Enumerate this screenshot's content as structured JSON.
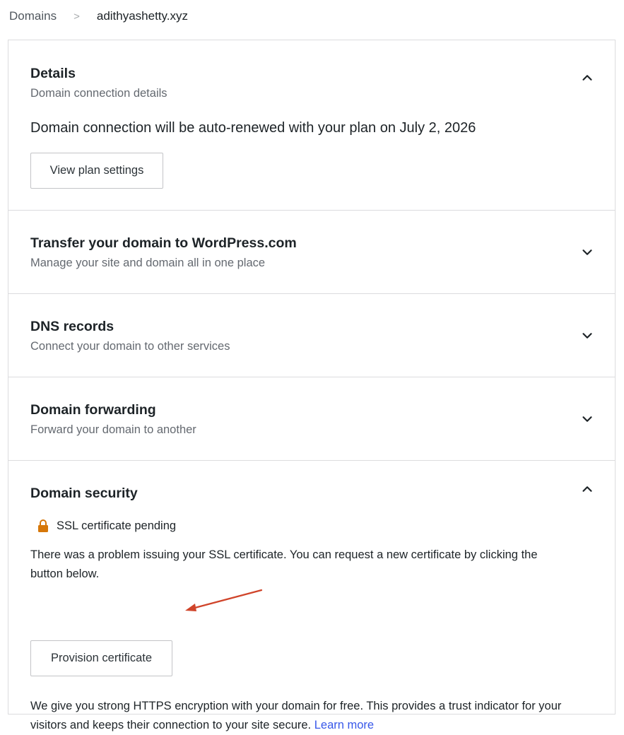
{
  "breadcrumb": {
    "root": "Domains",
    "separator": ">",
    "current": "adithyashetty.xyz"
  },
  "sections": {
    "details": {
      "title": "Details",
      "subtitle": "Domain connection details",
      "renewal_text": "Domain connection will be auto-renewed with your plan on July 2, 2026",
      "button_label": "View plan settings",
      "expanded": true
    },
    "transfer": {
      "title": "Transfer your domain to WordPress.com",
      "subtitle": "Manage your site and domain all in one place",
      "expanded": false
    },
    "dns": {
      "title": "DNS records",
      "subtitle": "Connect your domain to other services",
      "expanded": false
    },
    "forwarding": {
      "title": "Domain forwarding",
      "subtitle": "Forward your domain to another",
      "expanded": false
    },
    "security": {
      "title": "Domain security",
      "ssl_status": "SSL certificate pending",
      "problem_text": "There was a problem issuing your SSL certificate. You can request a new certificate by clicking the button below.",
      "button_label": "Provision certificate",
      "https_text": "We give you strong HTTPS encryption with your domain for free. This provides a trust indicator for your visitors and keeps their connection to your site secure.",
      "learn_more": "Learn more",
      "expanded": true
    }
  },
  "icons": {
    "chevron_up": "chevron-up-icon",
    "chevron_down": "chevron-down-icon",
    "lock": "lock-icon",
    "annotation_arrow": "annotation-arrow-icon"
  },
  "colors": {
    "border": "#dcdcde",
    "link": "#3858e9",
    "lock": "#d67709",
    "annotation_arrow": "#d0442a"
  }
}
